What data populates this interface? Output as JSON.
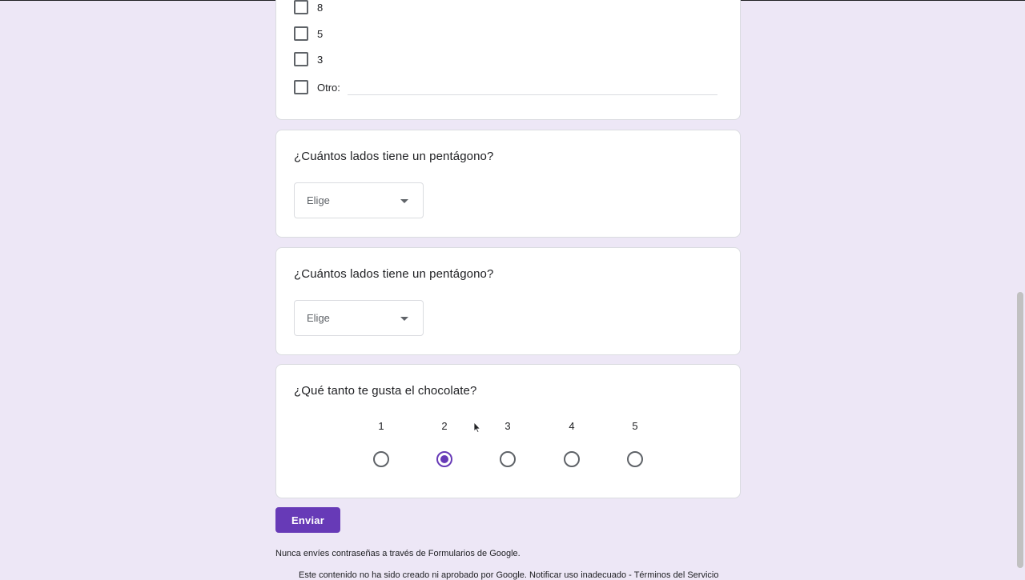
{
  "checkbox_question": {
    "options": [
      {
        "label": "8",
        "checked": false
      },
      {
        "label": "5",
        "checked": false
      },
      {
        "label": "3",
        "checked": false
      }
    ],
    "other_label": "Otro:"
  },
  "dropdown_questions": [
    {
      "title": "¿Cuántos lados tiene un pentágono?",
      "placeholder": "Elige"
    },
    {
      "title": "¿Cuántos lados tiene un pentágono?",
      "placeholder": "Elige"
    }
  ],
  "scale_question": {
    "title": "¿Qué tanto te gusta el chocolate?",
    "labels": [
      "1",
      "2",
      "3",
      "4",
      "5"
    ],
    "selected_value": 2
  },
  "submit_label": "Enviar",
  "footer": {
    "warning": "Nunca envíes contraseñas a través de Formularios de Google.",
    "disclaimer": "Este contenido no ha sido creado ni aprobado por Google. Notificar uso inadecuado - Términos del Servicio"
  },
  "colors": {
    "accent": "#673ab7",
    "background": "#ede7f6"
  },
  "icons": [
    "dropdown-arrow-icon",
    "mouse-cursor-icon"
  ]
}
